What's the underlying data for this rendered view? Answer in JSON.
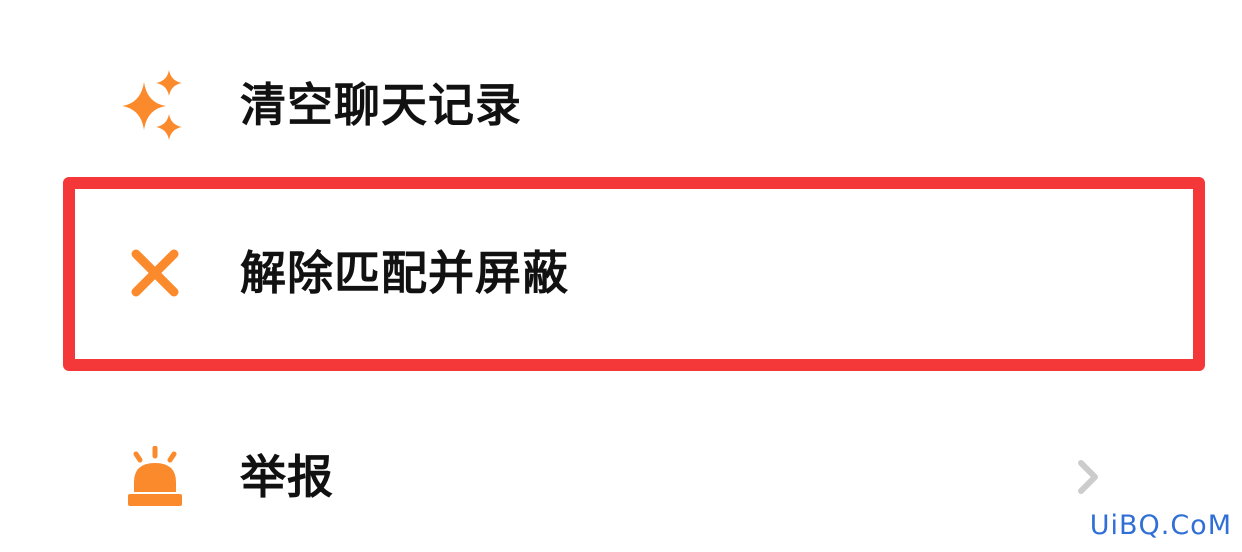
{
  "menu": {
    "items": [
      {
        "label": "清空聊天记录",
        "icon": "sparkle-icon"
      },
      {
        "label": "解除匹配并屏蔽",
        "icon": "close-icon"
      },
      {
        "label": "举报",
        "icon": "alarm-icon"
      }
    ]
  },
  "colors": {
    "icon_accent": "#fb8a2c",
    "highlight": "#f4383a",
    "label_text": "#111111",
    "chevron": "#cccccc"
  },
  "watermark": "UiBQ.CoM"
}
